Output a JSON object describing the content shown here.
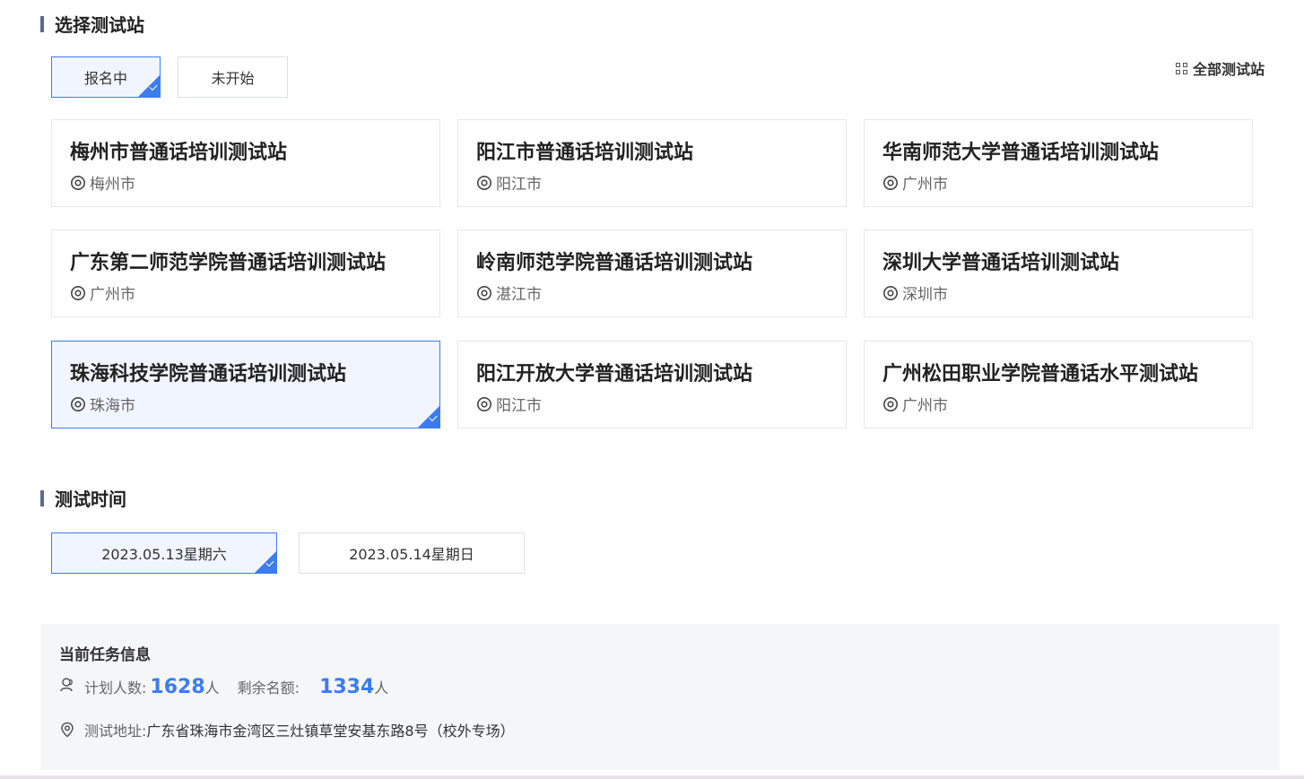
{
  "section_station": {
    "title": "选择测试站"
  },
  "status_tabs": [
    {
      "label": "报名中",
      "active": true
    },
    {
      "label": "未开始",
      "active": false
    }
  ],
  "all_stations_link": "全部测试站",
  "stations": [
    {
      "name": "梅州市普通话培训测试站",
      "city": "梅州市"
    },
    {
      "name": "阳江市普通话培训测试站",
      "city": "阳江市"
    },
    {
      "name": "华南师范大学普通话培训测试站",
      "city": "广州市"
    },
    {
      "name": "广东第二师范学院普通话培训测试站",
      "city": "广州市"
    },
    {
      "name": "岭南师范学院普通话培训测试站",
      "city": "湛江市"
    },
    {
      "name": "深圳大学普通话培训测试站",
      "city": "深圳市"
    },
    {
      "name": "珠海科技学院普通话培训测试站",
      "city": "珠海市",
      "active": true
    },
    {
      "name": "阳江开放大学普通话培训测试站",
      "city": "阳江市"
    },
    {
      "name": "广州松田职业学院普通话水平测试站",
      "city": "广州市"
    }
  ],
  "section_time": {
    "title": "测试时间"
  },
  "dates": [
    {
      "label": "2023.05.13星期六",
      "active": true
    },
    {
      "label": "2023.05.14星期日",
      "active": false
    }
  ],
  "info": {
    "title": "当前任务信息",
    "plan_label": "计划人数:",
    "plan_count": "1628",
    "plan_unit": "人",
    "remain_label": "剩余名额:",
    "remain_count": "1334",
    "remain_unit": "人",
    "address_label": "测试地址:",
    "address": "广东省珠海市金湾区三灶镇草堂安基东路8号（校外专场）"
  },
  "colors": {
    "accent": "#3b7cf0",
    "active_bg": "#f0f5ff",
    "border": "#e4e7ed"
  }
}
